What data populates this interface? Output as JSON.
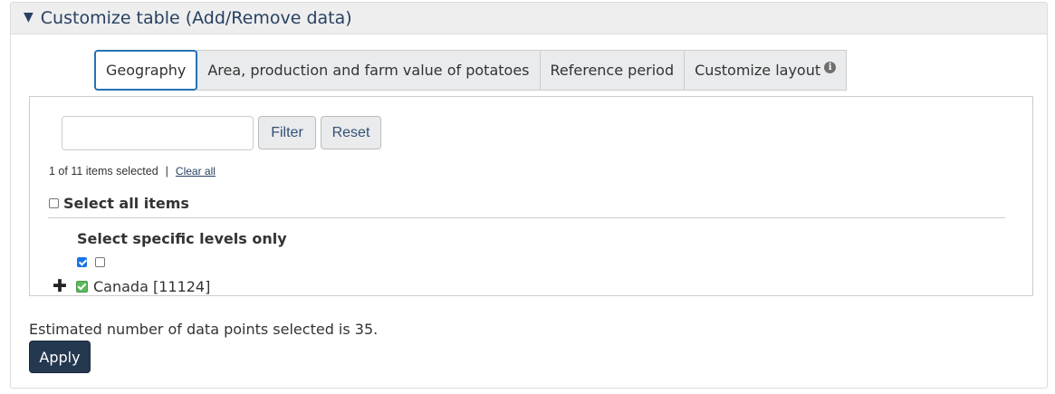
{
  "panel": {
    "title": "Customize table (Add/Remove data)",
    "toggle_icon": "triangle-down-icon"
  },
  "tabs": [
    {
      "label": "Geography",
      "active": true
    },
    {
      "label": "Area, production and farm value of potatoes",
      "active": false
    },
    {
      "label": "Reference period",
      "active": false
    },
    {
      "label": "Customize layout",
      "active": false,
      "icon": "info-icon"
    }
  ],
  "filter": {
    "input_value": "",
    "filter_label": "Filter",
    "reset_label": "Reset"
  },
  "selection": {
    "count_text": "1 of 11 items selected",
    "separator": "|",
    "clear_all_label": "Clear all",
    "select_all_label": "Select all items",
    "select_all_checked": false
  },
  "levels": {
    "title": "Select specific levels only",
    "level_checks": [
      true,
      false
    ]
  },
  "tree": {
    "items": [
      {
        "label": "Canada [11124]",
        "checked": true,
        "expand_icon": "plus-icon"
      }
    ]
  },
  "estimate_text": "Estimated number of data points selected is 35.",
  "apply_label": "Apply",
  "colors": {
    "header_text": "#284162",
    "active_tab_border": "#2572b4",
    "apply_bg": "#243850",
    "check_green": "#5cb85c"
  }
}
